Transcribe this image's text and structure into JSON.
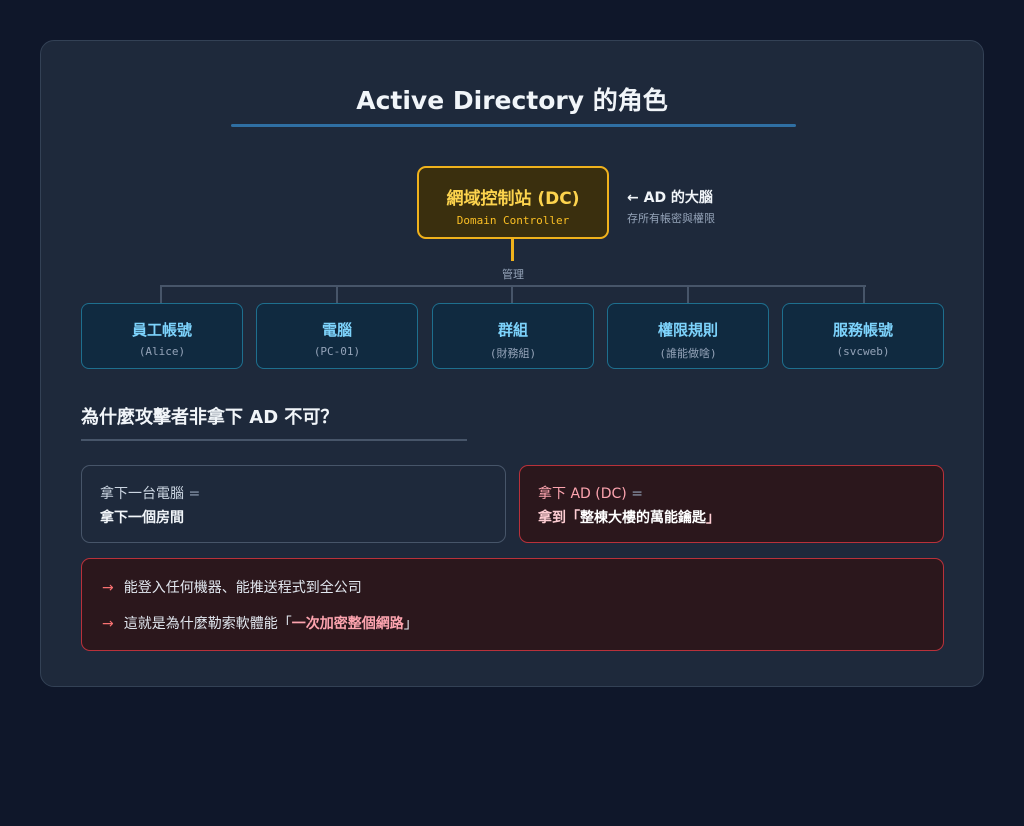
{
  "title": "Active Directory 的角色",
  "dc": {
    "title": "網域控制站 (DC)",
    "subtitle": "Domain Controller",
    "note_title": "← AD 的大腦",
    "note_sub": "存所有帳密與權限"
  },
  "manage_label": "管理",
  "children": [
    {
      "title": "員工帳號",
      "sub": "(Alice)"
    },
    {
      "title": "電腦",
      "sub": "(PC-01)"
    },
    {
      "title": "群組",
      "sub": "(財務組)"
    },
    {
      "title": "權限規則",
      "sub": "(誰能做啥)"
    },
    {
      "title": "服務帳號",
      "sub": "(svcweb)"
    }
  ],
  "question": "為什麼攻擊者非拿下 AD 不可？",
  "compare": {
    "left": {
      "line1": "拿下一台電腦",
      "eq": "=",
      "line2": "拿下一個房間"
    },
    "right": {
      "line1": "拿下 AD (DC)",
      "eq": "=",
      "line2_prefix": "拿到「",
      "line2_highlight": "整棟大樓的萬能鑰匙",
      "line2_suffix": "」"
    }
  },
  "bullets": {
    "arrow": "→",
    "b1": "能登入任何機器、能推送程式到全公司",
    "b2_prefix": "這就是為什麼勒索軟體能「",
    "b2_highlight": "一次加密整個網路",
    "b2_suffix": "」"
  },
  "colors": {
    "background": "#0f172a",
    "card": "#1e293b",
    "dc_border": "#f0b21c",
    "child_border": "#1e6f8e",
    "danger": "#b9313a",
    "accent_line": "#2f6fa3"
  }
}
